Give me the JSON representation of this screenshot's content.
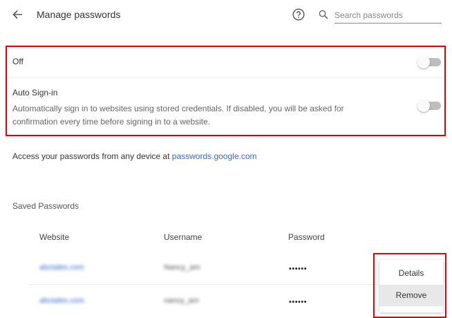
{
  "header": {
    "title": "Manage passwords",
    "search_placeholder": "Search passwords"
  },
  "settings": {
    "off_label": "Off",
    "off_toggle_on": false,
    "auto_signin_title": "Auto Sign-in",
    "auto_signin_description": "Automatically sign in to websites using stored credentials. If disabled, you will be asked for confirmation every time before signing in to a website.",
    "auto_signin_toggle_on": false
  },
  "access": {
    "prefix": "Access your passwords from any device at ",
    "link": "passwords.google.com"
  },
  "saved": {
    "title": "Saved Passwords",
    "columns": [
      "Website",
      "Username",
      "Password"
    ],
    "rows": [
      {
        "website": "abctales.com",
        "username": "Nancy_am",
        "password": "••••••"
      },
      {
        "website": "abctales.com",
        "username": "nancy_am",
        "password": "••••••"
      }
    ]
  },
  "context_menu": {
    "items": [
      "Details",
      "Remove"
    ],
    "highlighted": "Remove"
  },
  "colors": {
    "accent_link": "#3367d6",
    "annotation_red": "#e00000",
    "toggle_track_off": "#bdbdbd"
  },
  "icons": {
    "back": "arrow-back-icon",
    "help": "help-circle-icon",
    "search": "search-icon"
  }
}
